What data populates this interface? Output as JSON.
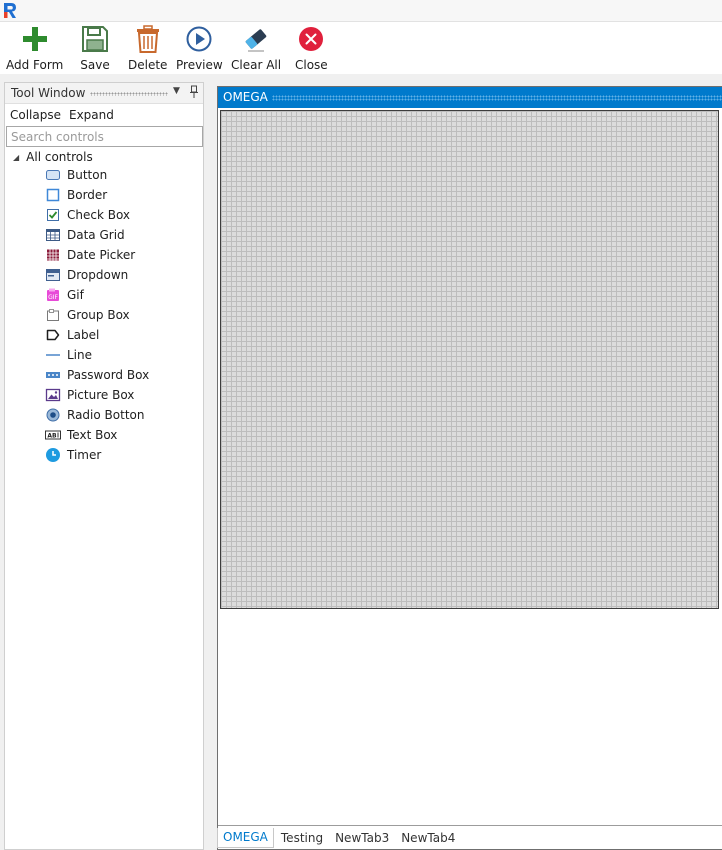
{
  "toolbar": {
    "buttons": [
      {
        "label": "Add Form",
        "icon": "plus-icon"
      },
      {
        "label": "Save",
        "icon": "floppy-icon"
      },
      {
        "label": "Delete",
        "icon": "trash-icon"
      },
      {
        "label": "Preview",
        "icon": "play-icon"
      },
      {
        "label": "Clear All",
        "icon": "eraser-icon"
      },
      {
        "label": "Close",
        "icon": "close-icon"
      }
    ]
  },
  "tool_window": {
    "title": "Tool Window",
    "collapse_label": "Collapse",
    "expand_label": "Expand",
    "search_placeholder": "Search controls",
    "tree_root": "All controls",
    "controls": [
      {
        "label": "Button",
        "icon": "button-icon"
      },
      {
        "label": "Border",
        "icon": "border-icon"
      },
      {
        "label": "Check Box",
        "icon": "checkbox-icon"
      },
      {
        "label": "Data Grid",
        "icon": "datagrid-icon"
      },
      {
        "label": "Date Picker",
        "icon": "calendar-icon"
      },
      {
        "label": "Dropdown",
        "icon": "dropdown-icon"
      },
      {
        "label": "Gif",
        "icon": "gif-icon"
      },
      {
        "label": "Group Box",
        "icon": "groupbox-icon"
      },
      {
        "label": "Label",
        "icon": "label-icon"
      },
      {
        "label": "Line",
        "icon": "line-icon"
      },
      {
        "label": "Password Box",
        "icon": "password-icon"
      },
      {
        "label": "Picture Box",
        "icon": "picture-icon"
      },
      {
        "label": "Radio Botton",
        "icon": "radio-icon"
      },
      {
        "label": "Text Box",
        "icon": "textbox-icon"
      },
      {
        "label": "Timer",
        "icon": "timer-icon"
      }
    ]
  },
  "document": {
    "title": "OMEGA",
    "tabs": [
      "OMEGA",
      "Testing",
      "NewTab3",
      "NewTab4"
    ],
    "active_tab": "OMEGA"
  },
  "colors": {
    "accent": "#007acc",
    "add": "#2e8b2e",
    "save": "#4a7a4a",
    "delete": "#c8692d",
    "preview": "#2f5f9e",
    "close": "#e0203c"
  }
}
